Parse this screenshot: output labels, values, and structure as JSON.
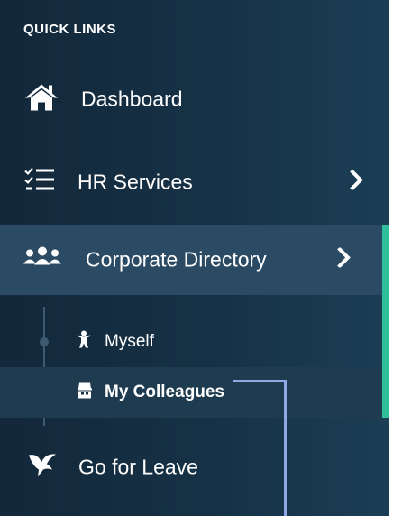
{
  "sidebar": {
    "section_title": "QUICK LINKS",
    "items": [
      {
        "label": "Dashboard",
        "icon": "home-icon"
      },
      {
        "label": "HR Services",
        "icon": "checklist-icon"
      },
      {
        "label": "Corporate Directory",
        "icon": "group-icon",
        "expanded": true
      },
      {
        "label": "Go for Leave",
        "icon": "bird-icon"
      }
    ],
    "subitems": [
      {
        "label": "Myself",
        "icon": "person-icon"
      },
      {
        "label": "My Colleagues",
        "icon": "colleagues-icon",
        "selected": true
      }
    ]
  },
  "colors": {
    "sidebar_bg": "#163146",
    "active_bg": "#2b4a63",
    "selected_sub_bg": "#1e3b50",
    "accent_bar": "#2fbf9a",
    "annotation": "#8fa9e6",
    "text": "#ffffff"
  }
}
